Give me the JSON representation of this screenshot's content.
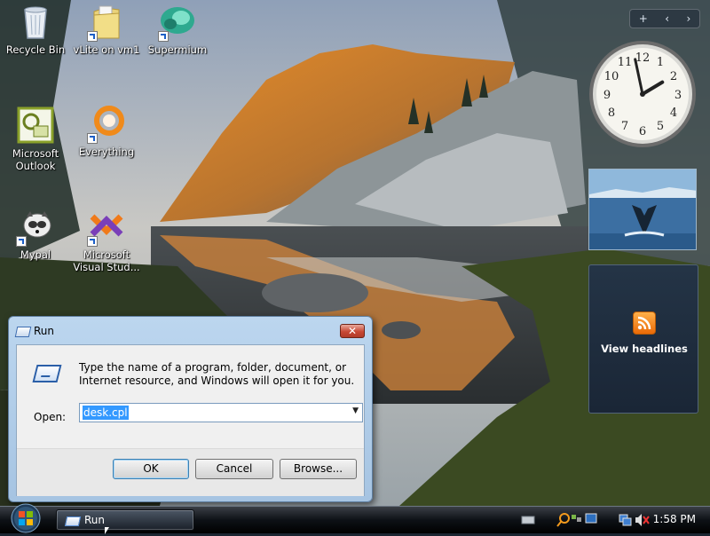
{
  "desktop": {
    "icons": [
      {
        "label": "Recycle Bin"
      },
      {
        "label": "vLite on vm1"
      },
      {
        "label": "Supermium"
      },
      {
        "label": "Microsoft Outlook"
      },
      {
        "label": "Everything"
      },
      {
        "label": "Mypal"
      },
      {
        "label": "Microsoft Visual Stud..."
      }
    ]
  },
  "sidebar": {
    "controls": {
      "add": "+",
      "prev": "‹",
      "next": "›"
    },
    "feed_headlines": "View headlines",
    "clock": {
      "hour": 1,
      "minute": 58
    }
  },
  "run_dialog": {
    "title": "Run",
    "close_label": "✕",
    "description": "Type the name of a program, folder, document, or Internet resource, and Windows will open it for you.",
    "open_label": "Open:",
    "open_value": "desk.cpl",
    "ok_label": "OK",
    "cancel_label": "Cancel",
    "browse_label": "Browse..."
  },
  "taskbar": {
    "tasks": [
      {
        "label": "Run"
      }
    ],
    "clock": "1:58 PM"
  },
  "colors": {
    "accent": "#3399ff",
    "close_red": "#c84834",
    "rss_orange": "#ea6a07"
  }
}
